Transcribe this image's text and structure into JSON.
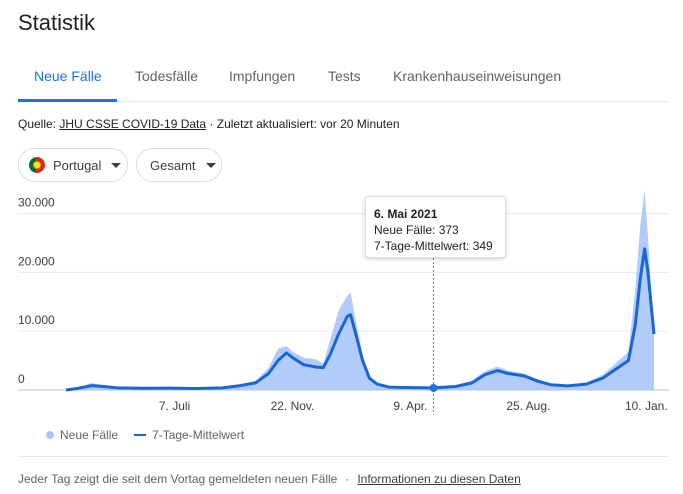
{
  "page": {
    "title": "Statistik"
  },
  "tabs": [
    "Neue Fälle",
    "Todesfälle",
    "Impfungen",
    "Tests",
    "Krankenhauseinweisungen"
  ],
  "active_tab": "Neue Fälle",
  "source": {
    "prefix": "Quelle: ",
    "link": "JHU CSSE COVID-19 Data",
    "suffix": " · Zuletzt aktualisiert: vor 20 Minuten"
  },
  "filters": {
    "country": "Portugal",
    "scope": "Gesamt"
  },
  "tooltip": {
    "date": "6. Mai 2021",
    "cases": "Neue Fälle: 373",
    "avg": "7-Tage-Mittelwert: 349"
  },
  "legend": {
    "bars": "Neue Fälle",
    "line": "7-Tage-Mittelwert"
  },
  "footer": {
    "text": "Jeder Tag zeigt die seit dem Vortag gemeldeten neuen Fälle",
    "separator": "·",
    "link": "Informationen zu diesen Daten"
  },
  "colors": {
    "accent": "#1a73e8",
    "bar": "#a8c7fa",
    "line": "#1a67d2"
  },
  "chart_data": {
    "type": "area",
    "title": "",
    "xlabel": "",
    "ylabel": "",
    "ylim": [
      0,
      34000
    ],
    "y_ticks": [
      "0",
      "10.000",
      "20.000",
      "30.000"
    ],
    "x_ticks": [
      "7. Juli",
      "22. Nov.",
      "9. Apr.",
      "25. Aug.",
      "10. Jan."
    ],
    "x_tick_dates": [
      "2020-07-07",
      "2020-11-22",
      "2021-04-09",
      "2021-08-25",
      "2022-01-10"
    ],
    "grid": true,
    "legend_position": "bottom-left",
    "highlight": {
      "date": "2021-05-06",
      "value": 349
    },
    "series": [
      {
        "name": "7-Tage-Mittelwert",
        "points": [
          [
            "2020-03-02",
            0
          ],
          [
            "2020-03-15",
            250
          ],
          [
            "2020-04-01",
            750
          ],
          [
            "2020-04-15",
            600
          ],
          [
            "2020-05-01",
            350
          ],
          [
            "2020-06-01",
            300
          ],
          [
            "2020-07-01",
            330
          ],
          [
            "2020-08-01",
            250
          ],
          [
            "2020-09-01",
            350
          ],
          [
            "2020-09-20",
            700
          ],
          [
            "2020-10-10",
            1200
          ],
          [
            "2020-10-25",
            2800
          ],
          [
            "2020-11-05",
            5000
          ],
          [
            "2020-11-15",
            6300
          ],
          [
            "2020-11-22",
            5500
          ],
          [
            "2020-12-05",
            4300
          ],
          [
            "2020-12-20",
            3900
          ],
          [
            "2020-12-28",
            3800
          ],
          [
            "2021-01-05",
            6000
          ],
          [
            "2021-01-15",
            9500
          ],
          [
            "2021-01-25",
            12500
          ],
          [
            "2021-01-29",
            12800
          ],
          [
            "2021-02-05",
            9000
          ],
          [
            "2021-02-12",
            5000
          ],
          [
            "2021-02-20",
            2000
          ],
          [
            "2021-03-01",
            1000
          ],
          [
            "2021-03-15",
            500
          ],
          [
            "2021-04-01",
            420
          ],
          [
            "2021-05-06",
            349
          ],
          [
            "2021-06-01",
            600
          ],
          [
            "2021-06-20",
            1200
          ],
          [
            "2021-07-05",
            2600
          ],
          [
            "2021-07-20",
            3300
          ],
          [
            "2021-08-01",
            2800
          ],
          [
            "2021-08-20",
            2400
          ],
          [
            "2021-09-05",
            1500
          ],
          [
            "2021-09-20",
            900
          ],
          [
            "2021-10-10",
            700
          ],
          [
            "2021-11-01",
            1000
          ],
          [
            "2021-11-20",
            2000
          ],
          [
            "2021-12-05",
            3500
          ],
          [
            "2021-12-20",
            5000
          ],
          [
            "2021-12-28",
            11000
          ],
          [
            "2022-01-03",
            19000
          ],
          [
            "2022-01-08",
            24000
          ],
          [
            "2022-01-12",
            20000
          ],
          [
            "2022-01-16",
            14000
          ],
          [
            "2022-01-19",
            9500
          ]
        ]
      },
      {
        "name": "Neue Fälle",
        "points": [
          [
            "2020-03-02",
            0
          ],
          [
            "2020-03-15",
            300
          ],
          [
            "2020-04-01",
            1200
          ],
          [
            "2020-04-15",
            800
          ],
          [
            "2020-05-01",
            450
          ],
          [
            "2020-06-01",
            400
          ],
          [
            "2020-07-01",
            420
          ],
          [
            "2020-08-01",
            300
          ],
          [
            "2020-09-01",
            450
          ],
          [
            "2020-09-20",
            900
          ],
          [
            "2020-10-10",
            1600
          ],
          [
            "2020-10-25",
            3800
          ],
          [
            "2020-11-05",
            7000
          ],
          [
            "2020-11-15",
            7500
          ],
          [
            "2020-11-22",
            6500
          ],
          [
            "2020-12-05",
            5500
          ],
          [
            "2020-12-20",
            5200
          ],
          [
            "2020-12-28",
            4500
          ],
          [
            "2021-01-05",
            8500
          ],
          [
            "2021-01-15",
            13500
          ],
          [
            "2021-01-25",
            16000
          ],
          [
            "2021-01-29",
            16500
          ],
          [
            "2021-02-05",
            11000
          ],
          [
            "2021-02-12",
            6000
          ],
          [
            "2021-02-20",
            2500
          ],
          [
            "2021-03-01",
            1200
          ],
          [
            "2021-03-15",
            600
          ],
          [
            "2021-04-01",
            550
          ],
          [
            "2021-05-06",
            373
          ],
          [
            "2021-06-01",
            800
          ],
          [
            "2021-06-20",
            1600
          ],
          [
            "2021-07-05",
            3200
          ],
          [
            "2021-07-20",
            4000
          ],
          [
            "2021-08-01",
            3300
          ],
          [
            "2021-08-20",
            2800
          ],
          [
            "2021-09-05",
            1800
          ],
          [
            "2021-09-20",
            1100
          ],
          [
            "2021-10-10",
            900
          ],
          [
            "2021-11-01",
            1300
          ],
          [
            "2021-11-20",
            2600
          ],
          [
            "2021-12-05",
            4500
          ],
          [
            "2021-12-20",
            6500
          ],
          [
            "2021-12-28",
            17000
          ],
          [
            "2022-01-03",
            28000
          ],
          [
            "2022-01-08",
            34000
          ],
          [
            "2022-01-12",
            26000
          ],
          [
            "2022-01-16",
            16000
          ],
          [
            "2022-01-19",
            11000
          ]
        ]
      }
    ]
  }
}
